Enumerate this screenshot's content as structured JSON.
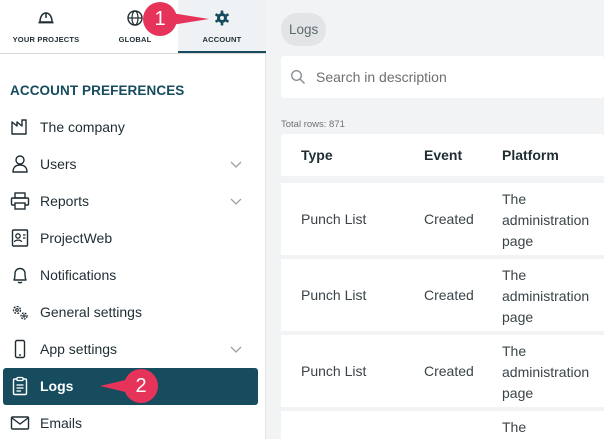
{
  "sidebar": {
    "tabs": [
      {
        "label": "YOUR PROJECTS",
        "icon": "helmet-icon"
      },
      {
        "label": "GLOBAL",
        "icon": "globe-icon"
      },
      {
        "label": "ACCOUNT",
        "icon": "gear-icon"
      }
    ],
    "section_title": "ACCOUNT PREFERENCES",
    "items": [
      {
        "label": "The company",
        "icon": "factory-icon"
      },
      {
        "label": "Users",
        "icon": "user-icon",
        "expandable": true
      },
      {
        "label": "Reports",
        "icon": "printer-icon",
        "expandable": true
      },
      {
        "label": "ProjectWeb",
        "icon": "id-card-icon"
      },
      {
        "label": "Notifications",
        "icon": "bell-icon"
      },
      {
        "label": "General settings",
        "icon": "cogs-icon"
      },
      {
        "label": "App settings",
        "icon": "phone-icon",
        "expandable": true
      },
      {
        "label": "Logs",
        "icon": "clipboard-icon",
        "active": true
      },
      {
        "label": "Emails",
        "icon": "envelope-icon"
      }
    ]
  },
  "main": {
    "breadcrumb": "Logs",
    "search": {
      "placeholder": "Search in description"
    },
    "total_rows": "Total rows: 871",
    "table": {
      "columns": [
        "Type",
        "Event",
        "Platform"
      ],
      "rows": [
        {
          "type": "Punch List",
          "event": "Created",
          "platform": "The administration page"
        },
        {
          "type": "Punch List",
          "event": "Created",
          "platform": "The administration page"
        },
        {
          "type": "Punch List",
          "event": "Created",
          "platform": "The administration page"
        },
        {
          "type": "",
          "event": "",
          "platform": "The"
        }
      ]
    }
  },
  "callouts": [
    "1",
    "2"
  ],
  "colors": {
    "accent": "#164c5e",
    "callout": "#e6335a",
    "background": "#f2f3f4"
  }
}
